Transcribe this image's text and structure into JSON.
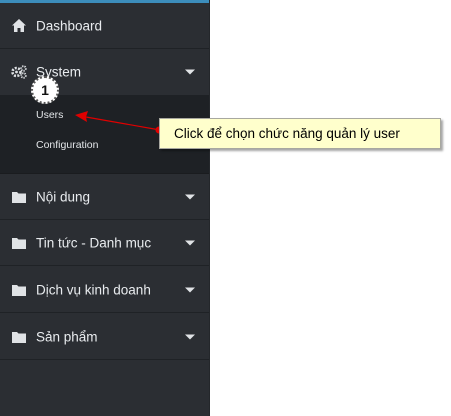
{
  "sidebar": {
    "menu": [
      {
        "label": "Dashboard",
        "icon": "home-icon",
        "has_submenu": false
      },
      {
        "label": "System",
        "icon": "cogs-icon",
        "has_submenu": true,
        "expanded": true
      },
      {
        "label": "Nội dung",
        "icon": "folder-icon",
        "has_submenu": true
      },
      {
        "label": "Tin tức - Danh mục",
        "icon": "folder-icon",
        "has_submenu": true
      },
      {
        "label": "Dịch vụ kinh doanh",
        "icon": "folder-icon",
        "has_submenu": true
      },
      {
        "label": "Sản phẩm",
        "icon": "folder-icon",
        "has_submenu": true
      }
    ],
    "system_submenu": [
      "Users",
      "Configuration"
    ]
  },
  "annotation": {
    "step_number": "1",
    "callout_text": "Click để chọn chức năng quản lý user",
    "arrow_color": "#e00000",
    "callout_bg": "#ffffcc"
  },
  "colors": {
    "sidebar_bg": "#2b2e33",
    "submenu_bg": "#1e2125",
    "accent": "#3c8dbc"
  }
}
